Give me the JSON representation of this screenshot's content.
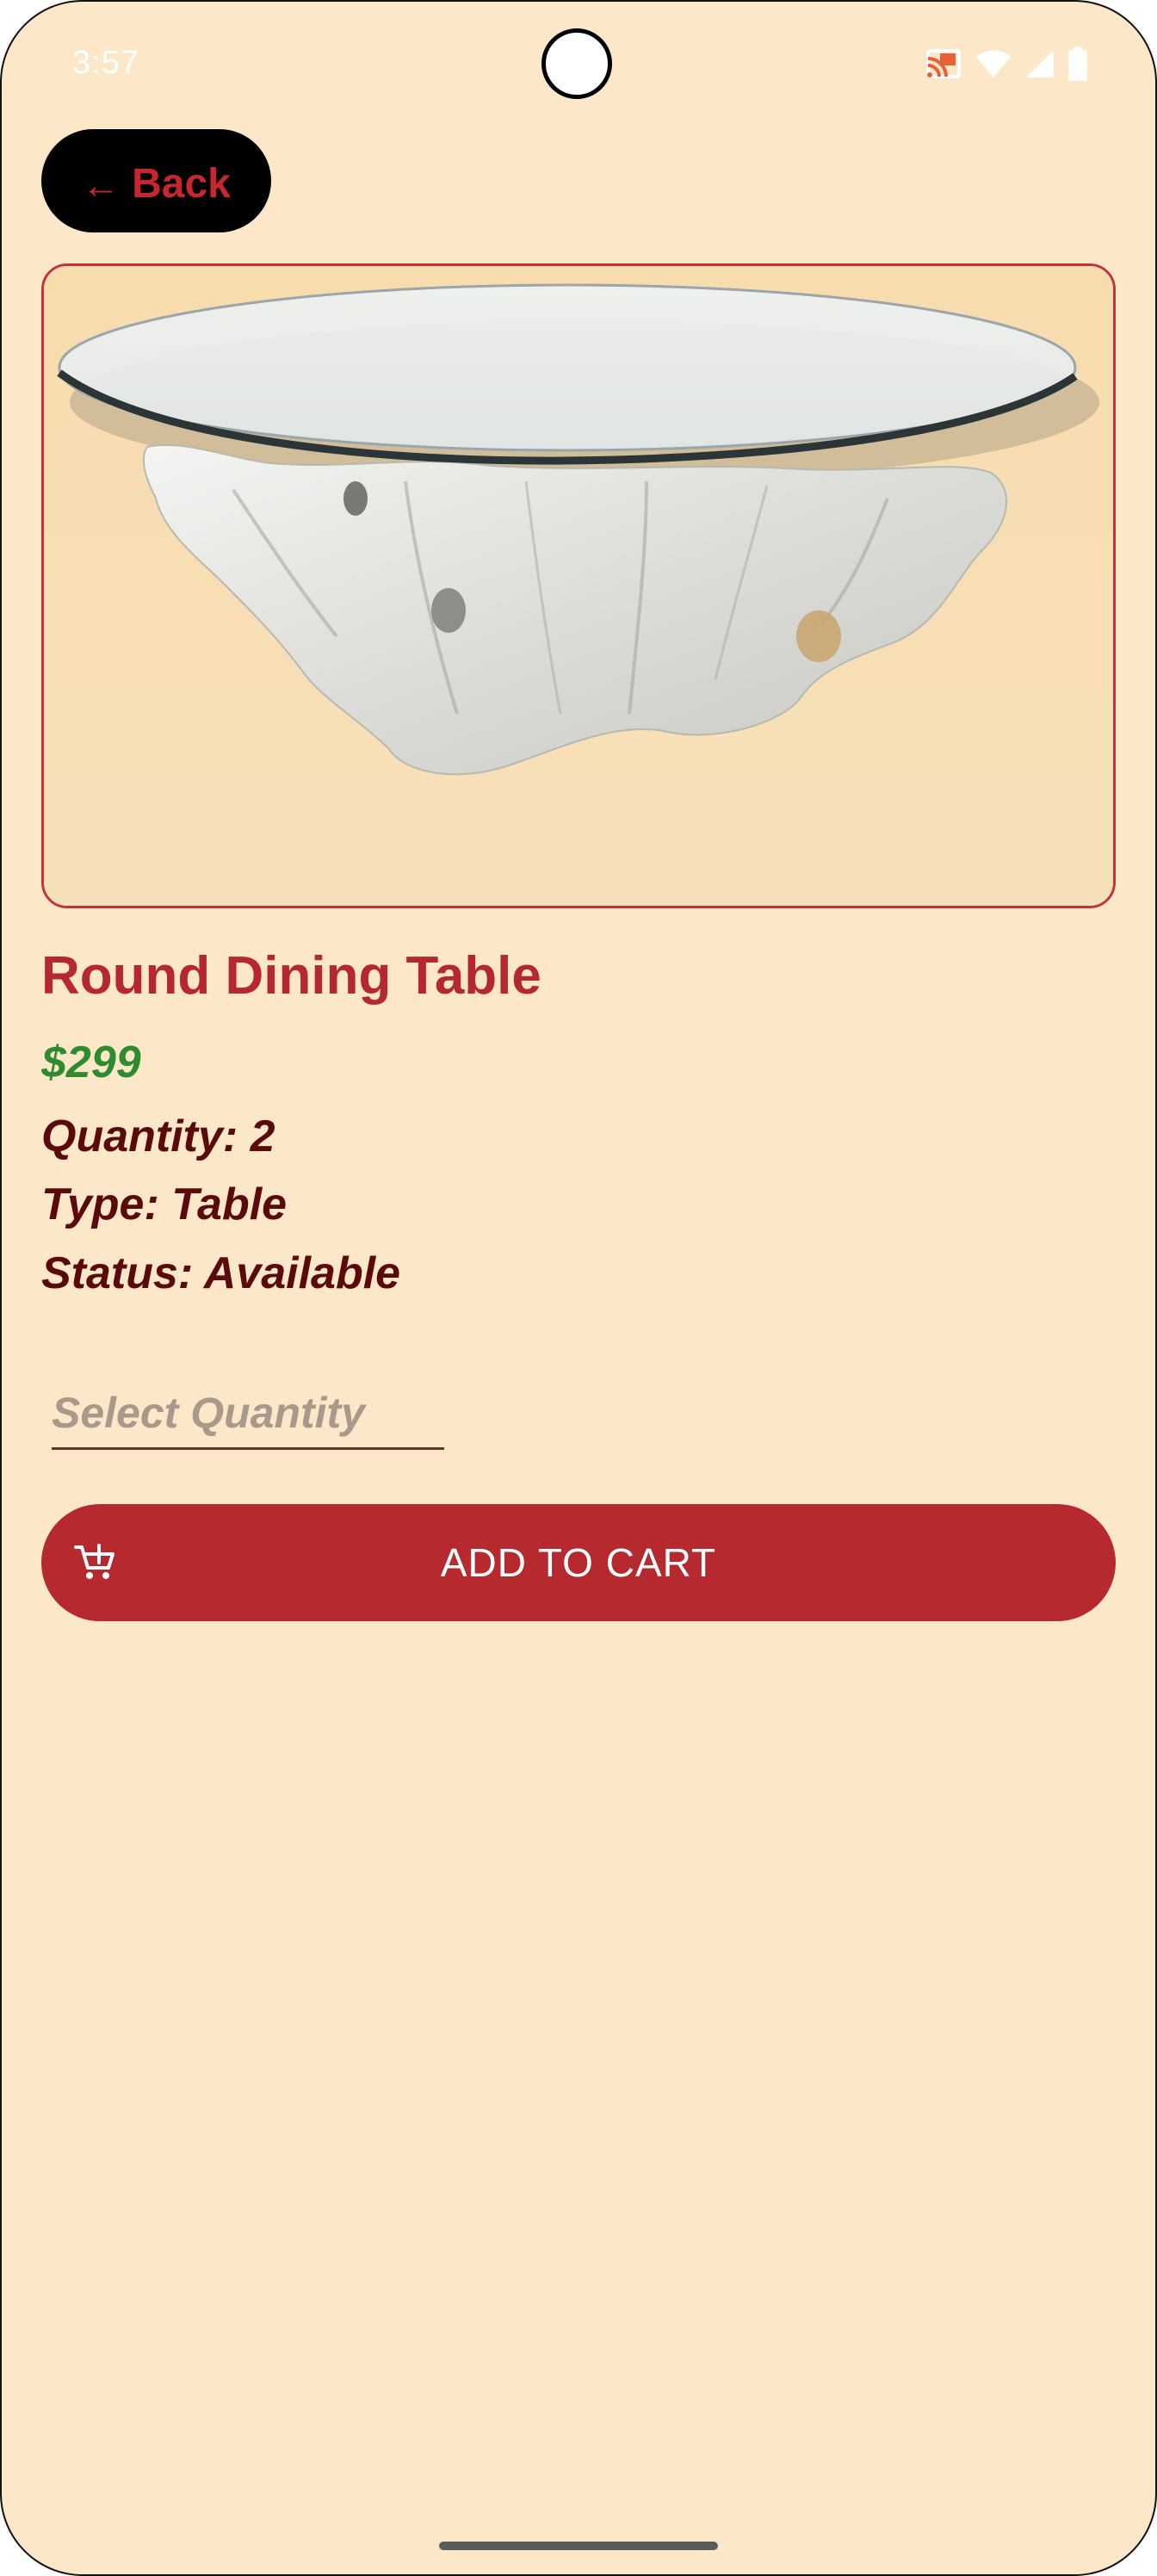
{
  "status_bar": {
    "time": "3:57",
    "icons": [
      "cast-icon",
      "wifi-icon",
      "signal-icon",
      "battery-icon"
    ]
  },
  "back_button": {
    "arrow": "←",
    "label": "Back"
  },
  "product": {
    "image_alt": "glass top round table on white driftwood base",
    "title": "Round Dining Table",
    "price": "$299",
    "quantity": "Quantity: 2",
    "type": "Type: Table",
    "status": "Status: Available"
  },
  "quantity_field": {
    "placeholder": "Select Quantity",
    "value": ""
  },
  "add_to_cart": {
    "label": "ADD TO CART",
    "icon": "add-shopping-cart-icon"
  },
  "colors": {
    "background": "#fce8c9",
    "accent": "#b5292f",
    "price": "#2e8b2e",
    "info_text": "#5a0a0a"
  }
}
